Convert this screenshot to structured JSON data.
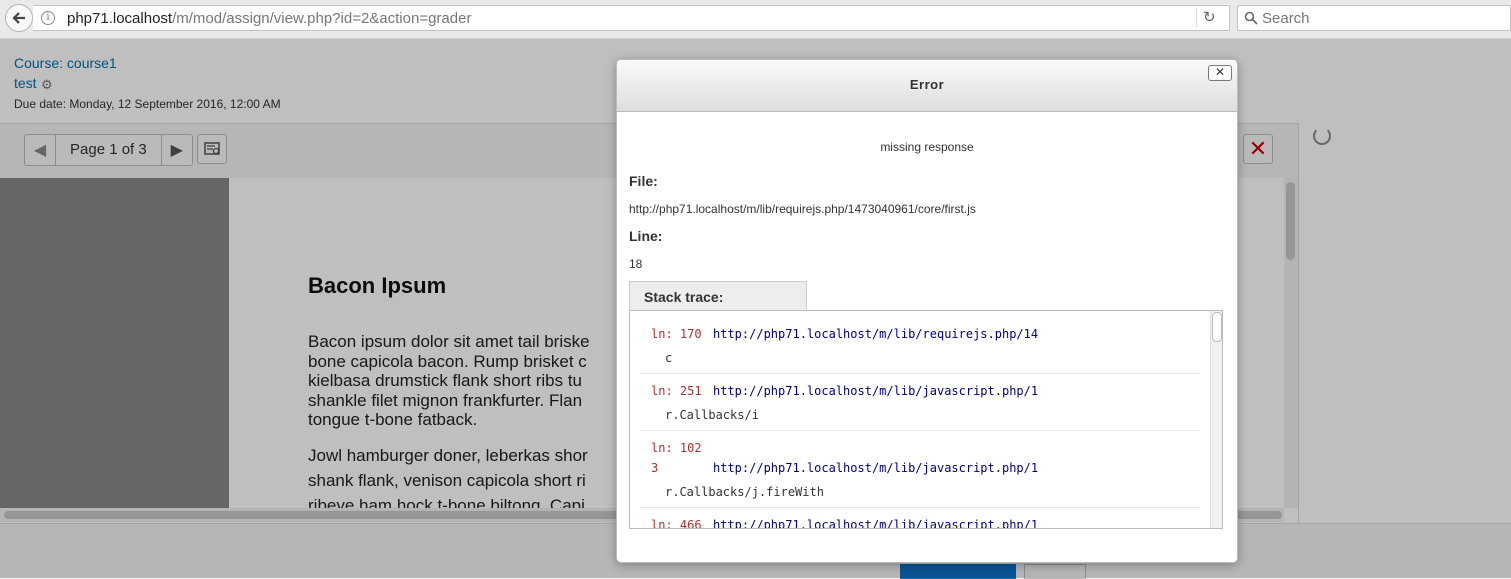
{
  "browser": {
    "url_host": "php71.localhost",
    "url_path": "/m/mod/assign/view.php?id=2&action=grader",
    "search_placeholder": "Search"
  },
  "header": {
    "course_link": "Course: course1",
    "assignment_link": "test",
    "due_date": "Due date: Monday, 12 September 2016, 12:00 AM"
  },
  "toolbar": {
    "page_label": "Page 1 of 3"
  },
  "pdf": {
    "heading": "Bacon Ipsum",
    "para1_lines": [
      "Bacon ipsum dolor sit amet tail briske",
      "bone capicola bacon. Rump brisket c",
      "kielbasa drumstick flank short ribs tu",
      "shankle filet mignon frankfurter. Flan",
      "tongue t-bone fatback."
    ],
    "para2_lines": [
      "Jowl hamburger doner, leberkas shor",
      "shank flank, venison capicola short ri",
      "ribeye ham hock t-bone biltong. Capi"
    ]
  },
  "dialog": {
    "title": "Error",
    "close_label": "✕",
    "message": "missing response",
    "file_label": "File:",
    "file_value": "http://php71.localhost/m/lib/requirejs.php/1473040961/core/first.js",
    "line_label": "Line:",
    "line_value": "18",
    "stack_label": "Stack trace:",
    "stack": [
      {
        "ln": "ln: 170",
        "url": "http://php71.localhost/m/lib/requirejs.php/14",
        "fn": "c"
      },
      {
        "ln": "ln: 251",
        "url": "http://php71.localhost/m/lib/javascript.php/1",
        "fn": "r.Callbacks/i"
      },
      {
        "ln": "ln: 102",
        "ln2": "3",
        "url": "http://php71.localhost/m/lib/javascript.php/1",
        "fn": "r.Callbacks/j.fireWith"
      },
      {
        "ln": "ln: 466",
        "url": "http://php71.localhost/m/lib/javascript.php/1",
        "fn": ""
      }
    ]
  },
  "icons": {
    "back": "back-arrow-icon",
    "info": "info-icon",
    "reload": "reload-icon",
    "search": "search-icon",
    "gear": "gear-icon",
    "prev": "triangle-left-icon",
    "next": "triangle-right-icon",
    "comments": "comment-search-icon",
    "close": "close-icon",
    "spinner": "loading-spinner-icon"
  },
  "colors": {
    "link": "#0070a8",
    "error_line": "#b03030",
    "stack_url": "#000080",
    "close_red": "#cc0000"
  }
}
